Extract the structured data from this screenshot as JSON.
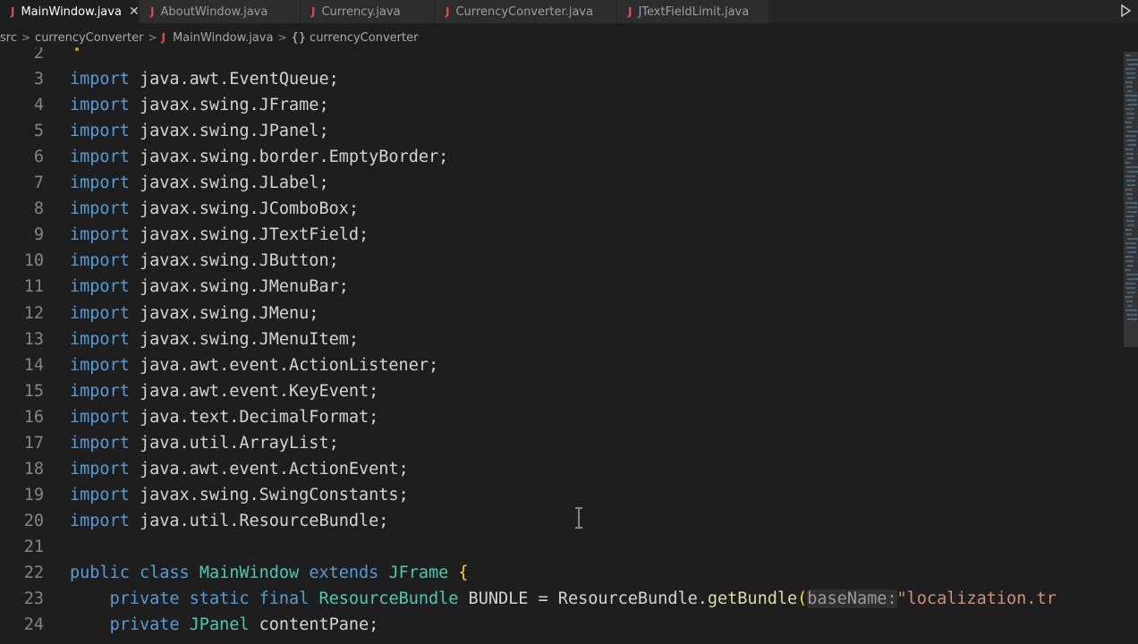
{
  "tabs": [
    {
      "label": "MainWindow.java",
      "icon": "java-file-icon",
      "active": true
    },
    {
      "label": "AboutWindow.java",
      "icon": "java-file-icon",
      "active": false
    },
    {
      "label": "Currency.java",
      "icon": "java-file-icon",
      "active": false
    },
    {
      "label": "CurrencyConverter.java",
      "icon": "java-file-icon",
      "active": false
    },
    {
      "label": "JTextFieldLimit.java",
      "icon": "java-file-icon",
      "active": false
    }
  ],
  "tab_icon_glyph": "J",
  "close_glyph": "✕",
  "breadcrumb": {
    "segments": [
      "src",
      "currencyConverter",
      "MainWindow.java",
      "currencyConverter"
    ],
    "separator": ">",
    "braces_glyph": "{}"
  },
  "editor": {
    "lines": [
      {
        "n": "2",
        "tokens": []
      },
      {
        "n": "3",
        "tokens": [
          [
            "kw",
            "import"
          ],
          [
            "plain",
            " java.awt.EventQueue;"
          ]
        ]
      },
      {
        "n": "4",
        "tokens": [
          [
            "kw",
            "import"
          ],
          [
            "plain",
            " javax.swing.JFrame;"
          ]
        ]
      },
      {
        "n": "5",
        "tokens": [
          [
            "kw",
            "import"
          ],
          [
            "plain",
            " javax.swing.JPanel;"
          ]
        ]
      },
      {
        "n": "6",
        "tokens": [
          [
            "kw",
            "import"
          ],
          [
            "plain",
            " javax.swing.border.EmptyBorder;"
          ]
        ]
      },
      {
        "n": "7",
        "tokens": [
          [
            "kw",
            "import"
          ],
          [
            "plain",
            " javax.swing.JLabel;"
          ]
        ]
      },
      {
        "n": "8",
        "tokens": [
          [
            "kw",
            "import"
          ],
          [
            "plain",
            " javax.swing.JComboBox;"
          ]
        ]
      },
      {
        "n": "9",
        "tokens": [
          [
            "kw",
            "import"
          ],
          [
            "plain",
            " javax.swing.JTextField;"
          ]
        ]
      },
      {
        "n": "10",
        "tokens": [
          [
            "kw",
            "import"
          ],
          [
            "plain",
            " javax.swing.JButton;"
          ]
        ]
      },
      {
        "n": "11",
        "tokens": [
          [
            "kw",
            "import"
          ],
          [
            "plain",
            " javax.swing.JMenuBar;"
          ]
        ]
      },
      {
        "n": "12",
        "tokens": [
          [
            "kw",
            "import"
          ],
          [
            "plain",
            " javax.swing.JMenu;"
          ]
        ]
      },
      {
        "n": "13",
        "tokens": [
          [
            "kw",
            "import"
          ],
          [
            "plain",
            " javax.swing.JMenuItem;"
          ]
        ]
      },
      {
        "n": "14",
        "tokens": [
          [
            "kw",
            "import"
          ],
          [
            "plain",
            " java.awt.event.ActionListener;"
          ]
        ]
      },
      {
        "n": "15",
        "tokens": [
          [
            "kw",
            "import"
          ],
          [
            "plain",
            " java.awt.event.KeyEvent;"
          ]
        ]
      },
      {
        "n": "16",
        "tokens": [
          [
            "kw",
            "import"
          ],
          [
            "plain",
            " java.text.DecimalFormat;"
          ]
        ]
      },
      {
        "n": "17",
        "tokens": [
          [
            "kw",
            "import"
          ],
          [
            "plain",
            " java.util.ArrayList;"
          ]
        ]
      },
      {
        "n": "18",
        "tokens": [
          [
            "kw",
            "import"
          ],
          [
            "plain",
            " java.awt.event.ActionEvent;"
          ]
        ]
      },
      {
        "n": "19",
        "tokens": [
          [
            "kw",
            "import"
          ],
          [
            "plain",
            " javax.swing.SwingConstants;"
          ]
        ]
      },
      {
        "n": "20",
        "tokens": [
          [
            "kw",
            "import"
          ],
          [
            "plain",
            " java.util.ResourceBundle;"
          ]
        ]
      },
      {
        "n": "21",
        "tokens": []
      },
      {
        "n": "22",
        "tokens": [
          [
            "kw",
            "public"
          ],
          [
            "plain",
            " "
          ],
          [
            "kw",
            "class"
          ],
          [
            "plain",
            " "
          ],
          [
            "ty",
            "MainWindow"
          ],
          [
            "plain",
            " "
          ],
          [
            "kw",
            "extends"
          ],
          [
            "plain",
            " "
          ],
          [
            "ty",
            "JFrame"
          ],
          [
            "plain",
            " "
          ],
          [
            "brace",
            "{"
          ]
        ]
      },
      {
        "n": "23",
        "tokens": [
          [
            "plain",
            "    "
          ],
          [
            "kw",
            "private"
          ],
          [
            "plain",
            " "
          ],
          [
            "kw",
            "static"
          ],
          [
            "plain",
            " "
          ],
          [
            "kw",
            "final"
          ],
          [
            "plain",
            " "
          ],
          [
            "ty",
            "ResourceBundle"
          ],
          [
            "plain",
            " BUNDLE = ResourceBundle."
          ],
          [
            "fn",
            "getBundle"
          ],
          [
            "brace",
            "("
          ],
          [
            "hint",
            "baseName:"
          ],
          [
            "st",
            "\"localization.tr"
          ]
        ]
      },
      {
        "n": "24",
        "tokens": [
          [
            "plain",
            "    "
          ],
          [
            "kw",
            "private"
          ],
          [
            "plain",
            " "
          ],
          [
            "ty",
            "JPanel"
          ],
          [
            "plain",
            " contentPane;"
          ]
        ]
      }
    ]
  }
}
